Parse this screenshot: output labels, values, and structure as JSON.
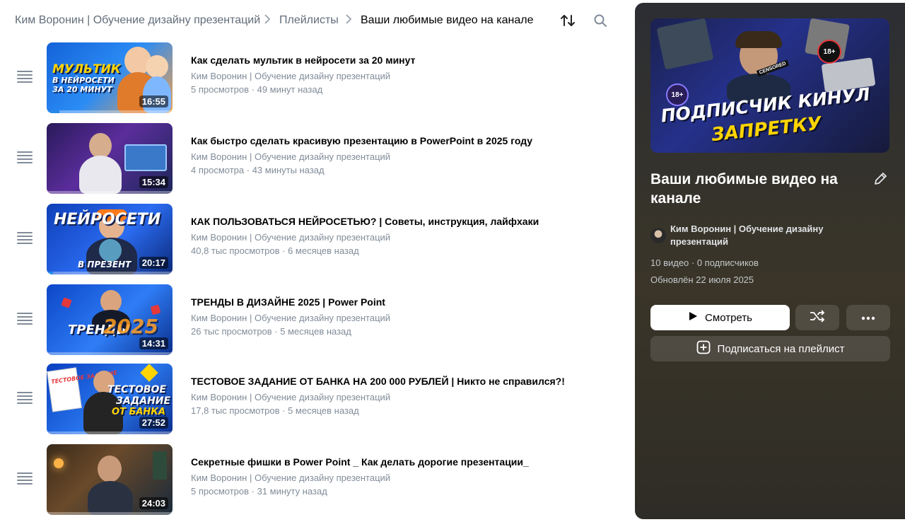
{
  "breadcrumb": {
    "channel": "Ким Воронин | Обучение дизайну презентаций",
    "section": "Плейлисты",
    "current": "Ваши любимые видео на канале"
  },
  "icons": {
    "sort": "sort-icon",
    "search": "search-icon",
    "drag": "drag-handle-icon",
    "edit": "pencil-icon",
    "play": "play-icon",
    "shuffle": "shuffle-icon",
    "more": "more-dots-icon",
    "add": "plus-square-icon"
  },
  "videos": [
    {
      "title": "Как сделать мультик в нейросети за 20 минут",
      "channel": "Ким Воронин | Обучение дизайну презентаций",
      "meta": "5 просмотров · 49 минут назад",
      "duration": "16:55",
      "thumb_text": [
        "МУЛЬТИК",
        "В НЕЙРОСЕТИ",
        "ЗА 20 МИНУТ"
      ],
      "watched": 0.1
    },
    {
      "title": "Как быстро сделать красивую презентацию в PowerPoint в 2025 году",
      "channel": "Ким Воронин | Обучение дизайну презентаций",
      "meta": "4 просмотра · 43 минуты назад",
      "duration": "15:34",
      "thumb_text": [],
      "watched": 0
    },
    {
      "title": "КАК ПОЛЬЗОВАТЬСЯ НЕЙРОСЕТЬЮ? | Советы, инструкция, лайфхаки",
      "channel": "Ким Воронин | Обучение дизайну презентаций",
      "meta": "40,8 тыс просмотров · 6 месяцев назад",
      "duration": "20:17",
      "thumb_text": [
        "НЕЙРОСЕТИ",
        "В ПРЕЗЕНТ"
      ],
      "watched": 0.05
    },
    {
      "title": "ТРЕНДЫ В ДИЗАЙНЕ 2025 | Power Point",
      "channel": "Ким Воронин | Обучение дизайну презентаций",
      "meta": "26 тыс просмотров · 5 месяцев назад",
      "duration": "14:31",
      "thumb_text": [
        "ТРЕНДЫ",
        "2025"
      ],
      "watched": 0
    },
    {
      "title": "ТЕСТОВОЕ ЗАДАНИЕ ОТ БАНКА НА 200 000 РУБЛЕЙ | Никто не справился?!",
      "channel": "Ким Воронин | Обучение дизайну презентаций",
      "meta": "17,8 тыс просмотров · 5 месяцев назад",
      "duration": "27:52",
      "thumb_text": [
        "ТЕСТОВОЕ",
        "ЗАДАНИЕ",
        "ОТ БАНКА",
        "ТЕСТОВОЕ ЗАДАНИЕ"
      ],
      "watched": 0
    },
    {
      "title": "Секретные фишки в Power Point _ Как делать дорогие презентации_",
      "channel": "Ким Воронин | Обучение дизайну презентаций",
      "meta": "5 просмотров · 31 минуту назад",
      "duration": "24:03",
      "thumb_text": [],
      "watched": 0
    }
  ],
  "playlist": {
    "cover_text": [
      "ПОДПИСЧИК КИНУЛ",
      "ЗАПРЕТКУ"
    ],
    "cover_badges": [
      "18+",
      "18+",
      "CENSORED"
    ],
    "title": "Ваши любимые видео на канале",
    "owner": "Ким Воронин | Обучение дизайну презентаций",
    "stats": "10 видео · 0 подписчиков",
    "updated": "Обновлён 22 июля 2025",
    "watch_label": "Смотреть",
    "subscribe_label": "Подписаться на плейлист"
  },
  "colors": {
    "accent": "#2688eb",
    "muted_text": "#818c99",
    "panel_bg": "#2c2e33"
  }
}
